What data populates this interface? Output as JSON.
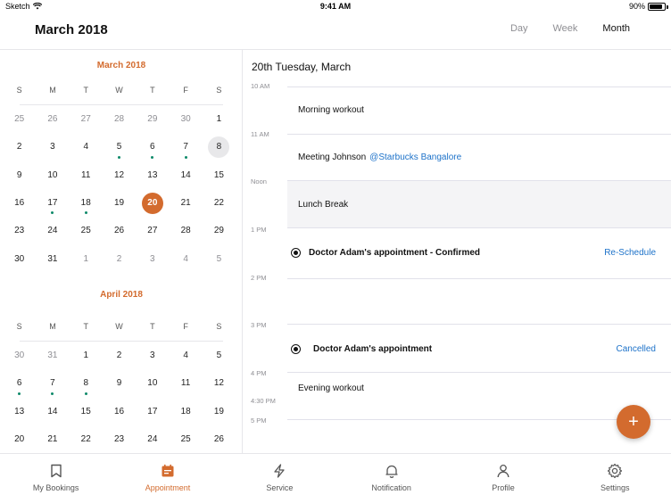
{
  "status_bar": {
    "carrier": "Sketch",
    "time": "9:41 AM",
    "battery": "90%",
    "battery_level": 0.9
  },
  "header": {
    "title": "March 2018",
    "views": [
      "Day",
      "Week",
      "Month"
    ],
    "active_view": "Month"
  },
  "calendar": {
    "weekdays": [
      "S",
      "M",
      "T",
      "W",
      "T",
      "F",
      "S"
    ],
    "march": {
      "title": "March 2018",
      "days": [
        {
          "d": "25",
          "m": true
        },
        {
          "d": "26",
          "m": true
        },
        {
          "d": "27",
          "m": true
        },
        {
          "d": "28",
          "m": true
        },
        {
          "d": "29",
          "m": true
        },
        {
          "d": "30",
          "m": true
        },
        {
          "d": "1"
        },
        {
          "d": "2"
        },
        {
          "d": "3"
        },
        {
          "d": "4"
        },
        {
          "d": "5",
          "dot": true
        },
        {
          "d": "6",
          "dot": true
        },
        {
          "d": "7",
          "dot": true
        },
        {
          "d": "8",
          "grey": true
        },
        {
          "d": "9"
        },
        {
          "d": "10"
        },
        {
          "d": "11"
        },
        {
          "d": "12"
        },
        {
          "d": "13"
        },
        {
          "d": "14"
        },
        {
          "d": "15"
        },
        {
          "d": "16"
        },
        {
          "d": "17",
          "dot": true
        },
        {
          "d": "18",
          "dot": true
        },
        {
          "d": "19"
        },
        {
          "d": "20",
          "sel": true
        },
        {
          "d": "21"
        },
        {
          "d": "22"
        },
        {
          "d": "23"
        },
        {
          "d": "24"
        },
        {
          "d": "25"
        },
        {
          "d": "26"
        },
        {
          "d": "27"
        },
        {
          "d": "28"
        },
        {
          "d": "29"
        },
        {
          "d": "30"
        },
        {
          "d": "31"
        },
        {
          "d": "1",
          "m": true
        },
        {
          "d": "2",
          "m": true
        },
        {
          "d": "3",
          "m": true
        },
        {
          "d": "4",
          "m": true
        },
        {
          "d": "5",
          "m": true
        }
      ]
    },
    "april": {
      "title": "April 2018",
      "days": [
        {
          "d": "30",
          "m": true
        },
        {
          "d": "31",
          "m": true
        },
        {
          "d": "1"
        },
        {
          "d": "2"
        },
        {
          "d": "3"
        },
        {
          "d": "4"
        },
        {
          "d": "5"
        },
        {
          "d": "6",
          "dot": true
        },
        {
          "d": "7",
          "dot": true
        },
        {
          "d": "8",
          "dot": true
        },
        {
          "d": "9"
        },
        {
          "d": "10"
        },
        {
          "d": "11"
        },
        {
          "d": "12"
        },
        {
          "d": "13"
        },
        {
          "d": "14"
        },
        {
          "d": "15"
        },
        {
          "d": "16"
        },
        {
          "d": "17"
        },
        {
          "d": "18"
        },
        {
          "d": "19"
        },
        {
          "d": "20"
        },
        {
          "d": "21"
        },
        {
          "d": "22"
        },
        {
          "d": "23"
        },
        {
          "d": "24"
        },
        {
          "d": "25"
        },
        {
          "d": "26"
        }
      ]
    }
  },
  "schedule": {
    "date_heading": "20th Tuesday, March",
    "time_labels": [
      "10 AM",
      "11 AM",
      "Noon",
      "1 PM",
      "2 PM",
      "3 PM",
      "4 PM",
      "4:30 PM",
      "5 PM"
    ],
    "events": {
      "morning": "Morning workout",
      "meeting": "Meeting Johnson",
      "meeting_place": "@Starbucks Bangalore",
      "lunch": "Lunch Break",
      "appt1": "Doctor Adam's appointment  -  Confirmed",
      "appt1_action": "Re-Schedule",
      "appt2": "Doctor Adam's appointment",
      "appt2_action": "Cancelled",
      "evening": "Evening workout"
    },
    "fab": "+"
  },
  "tabbar": [
    {
      "label": "My Bookings",
      "icon": "bookmark-icon"
    },
    {
      "label": "Appointment",
      "icon": "calendar-icon",
      "active": true
    },
    {
      "label": "Service",
      "icon": "lightning-icon"
    },
    {
      "label": "Notification",
      "icon": "bell-icon"
    },
    {
      "label": "Profile",
      "icon": "user-icon"
    },
    {
      "label": "Settings",
      "icon": "gear-icon"
    }
  ],
  "colors": {
    "accent": "#d36b2e",
    "link": "#1d72c9",
    "dot": "#0f8a6a"
  }
}
